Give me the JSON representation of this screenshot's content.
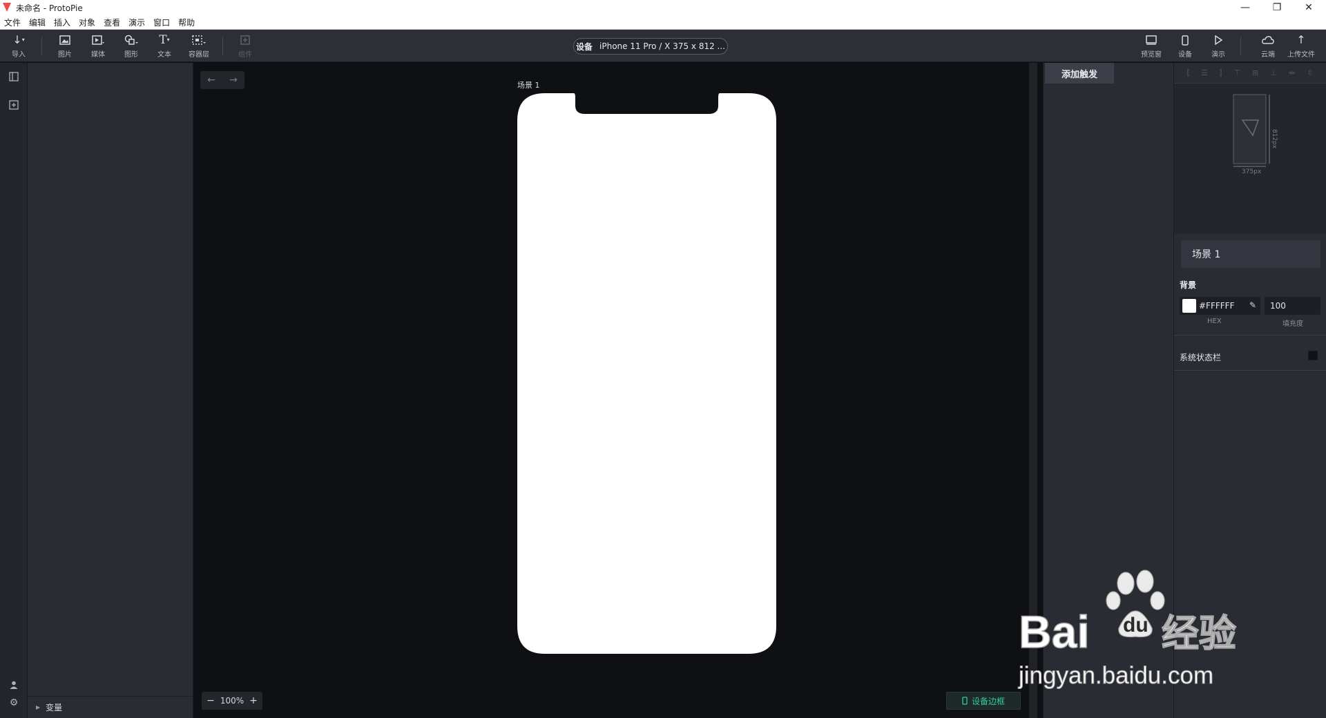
{
  "window": {
    "title": "未命名 - ProtoPie",
    "controls": [
      "minimize-icon",
      "restore-icon",
      "close-icon"
    ]
  },
  "menubar": {
    "items": [
      "文件",
      "编辑",
      "插入",
      "对象",
      "查看",
      "演示",
      "窗口",
      "帮助"
    ]
  },
  "toolbar": {
    "tools": [
      {
        "label": "导入",
        "icon": "import-icon"
      },
      {
        "label": "图片",
        "icon": "image-icon"
      },
      {
        "label": "媒体",
        "icon": "media-icon"
      },
      {
        "label": "图形",
        "icon": "shape-icon"
      },
      {
        "label": "文本",
        "icon": "text-icon"
      },
      {
        "label": "容器层",
        "icon": "container-icon"
      },
      {
        "label": "组件",
        "icon": "component-icon",
        "disabled": true
      }
    ],
    "device_select": {
      "key": "设备",
      "value": "iPhone 11 Pro / X  375 x 812 ..."
    },
    "right_tools": [
      {
        "label": "预览窗",
        "icon": "preview-window-icon"
      },
      {
        "label": "设备",
        "icon": "device-icon"
      },
      {
        "label": "演示",
        "icon": "play-icon"
      },
      {
        "label": "云端",
        "icon": "cloud-icon"
      },
      {
        "label": "上传文件",
        "icon": "upload-icon"
      }
    ]
  },
  "layers_panel": {
    "variables_label": "变量"
  },
  "canvas": {
    "scene_label": "场景 1",
    "zoom": "100%",
    "zoom_minus": "−",
    "zoom_plus": "+",
    "device_frame_label": "设备边框",
    "accent": "#2fcf9c"
  },
  "interaction_panel": {
    "add_trigger_label": "添加触发"
  },
  "properties": {
    "preview": {
      "width_label": "375px",
      "height_label": "812px"
    },
    "scene_name": "场景 1",
    "background_label": "背景",
    "hex_value": "#FFFFFF",
    "opacity_value": "100",
    "hex_caption": "HEX",
    "opacity_caption": "填充度",
    "status_bar_label": "系统状态栏"
  },
  "watermark": {
    "brand": "Bai",
    "brand2": "du",
    "cn": "经验",
    "url": "jingyan.baidu.com"
  }
}
